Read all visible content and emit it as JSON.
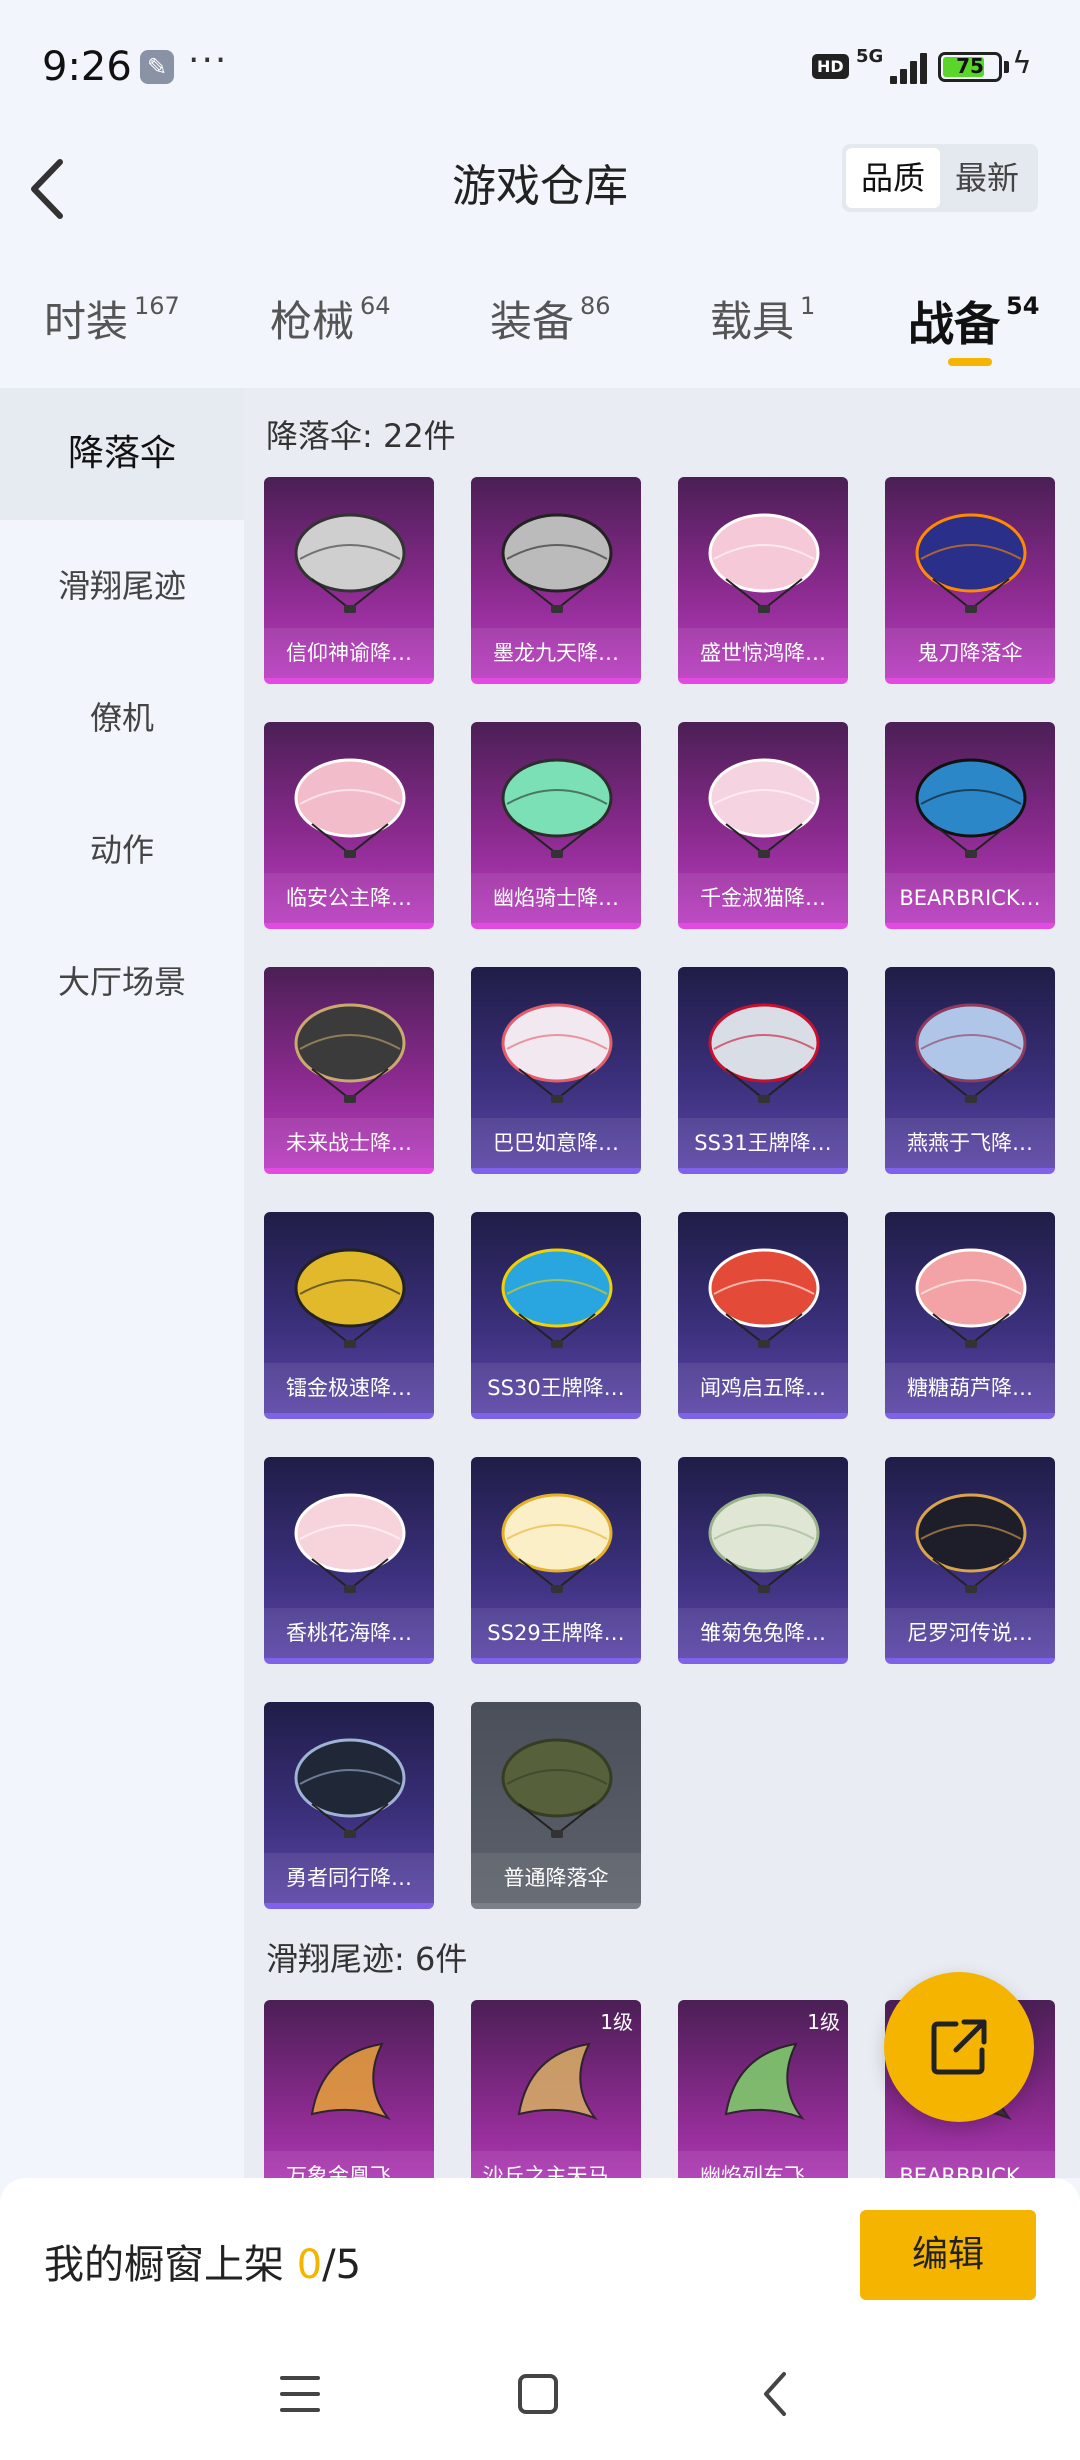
{
  "status_bar": {
    "time": "9:26",
    "network": "5G",
    "hd": "HD",
    "battery": "75",
    "battery_level": 0.75
  },
  "header": {
    "title": "游戏仓库",
    "sort_options": [
      "品质",
      "最新"
    ],
    "active_sort": "品质"
  },
  "tabs": [
    {
      "label": "时装",
      "count": "167"
    },
    {
      "label": "枪械",
      "count": "64"
    },
    {
      "label": "装备",
      "count": "86"
    },
    {
      "label": "载具",
      "count": "1"
    },
    {
      "label": "战备",
      "count": "54"
    }
  ],
  "sidebar": [
    "降落伞",
    "滑翔尾迹",
    "僚机",
    "动作",
    "大厅场景"
  ],
  "sections": [
    {
      "title": "降落伞: 22件",
      "items": [
        {
          "name": "信仰神谕降…",
          "rarity": "magenta"
        },
        {
          "name": "墨龙九天降…",
          "rarity": "magenta"
        },
        {
          "name": "盛世惊鸿降…",
          "rarity": "magenta"
        },
        {
          "name": "鬼刀降落伞",
          "rarity": "magenta"
        },
        {
          "name": "临安公主降…",
          "rarity": "magenta"
        },
        {
          "name": "幽焰骑士降…",
          "rarity": "magenta"
        },
        {
          "name": "千金淑猫降…",
          "rarity": "magenta"
        },
        {
          "name": "BEARBRICK…",
          "rarity": "magenta"
        },
        {
          "name": "未来战士降…",
          "rarity": "magenta"
        },
        {
          "name": "巴巴如意降…",
          "rarity": "purple"
        },
        {
          "name": "SS31王牌降…",
          "rarity": "purple"
        },
        {
          "name": "燕燕于飞降…",
          "rarity": "purple"
        },
        {
          "name": "镭金极速降…",
          "rarity": "purple"
        },
        {
          "name": "SS30王牌降…",
          "rarity": "purple"
        },
        {
          "name": "闻鸡启五降…",
          "rarity": "purple"
        },
        {
          "name": "糖糖葫芦降…",
          "rarity": "purple"
        },
        {
          "name": "香桃花海降…",
          "rarity": "purple"
        },
        {
          "name": "SS29王牌降…",
          "rarity": "purple"
        },
        {
          "name": "雏菊兔兔降…",
          "rarity": "purple"
        },
        {
          "name": "尼罗河传说…",
          "rarity": "purple"
        },
        {
          "name": "勇者同行降…",
          "rarity": "purple"
        },
        {
          "name": "普通降落伞",
          "rarity": "gray"
        }
      ]
    },
    {
      "title": "滑翔尾迹: 6件",
      "items": [
        {
          "name": "万象金凰飞…",
          "rarity": "magenta",
          "badge": ""
        },
        {
          "name": "沙丘之主天马…",
          "rarity": "magenta",
          "badge": "1级"
        },
        {
          "name": "幽焰列车飞…",
          "rarity": "magenta",
          "badge": "1级"
        },
        {
          "name": "BEARBRICK…",
          "rarity": "magenta",
          "badge": ""
        }
      ]
    }
  ],
  "bottom": {
    "showcase_label": "我的橱窗上架 ",
    "showcase_count": "0",
    "showcase_total": "/5",
    "edit_label": "编辑"
  },
  "colors": {
    "accent": "#f5b400",
    "magenta": "#b83cbf",
    "purple": "#5b45a6"
  }
}
